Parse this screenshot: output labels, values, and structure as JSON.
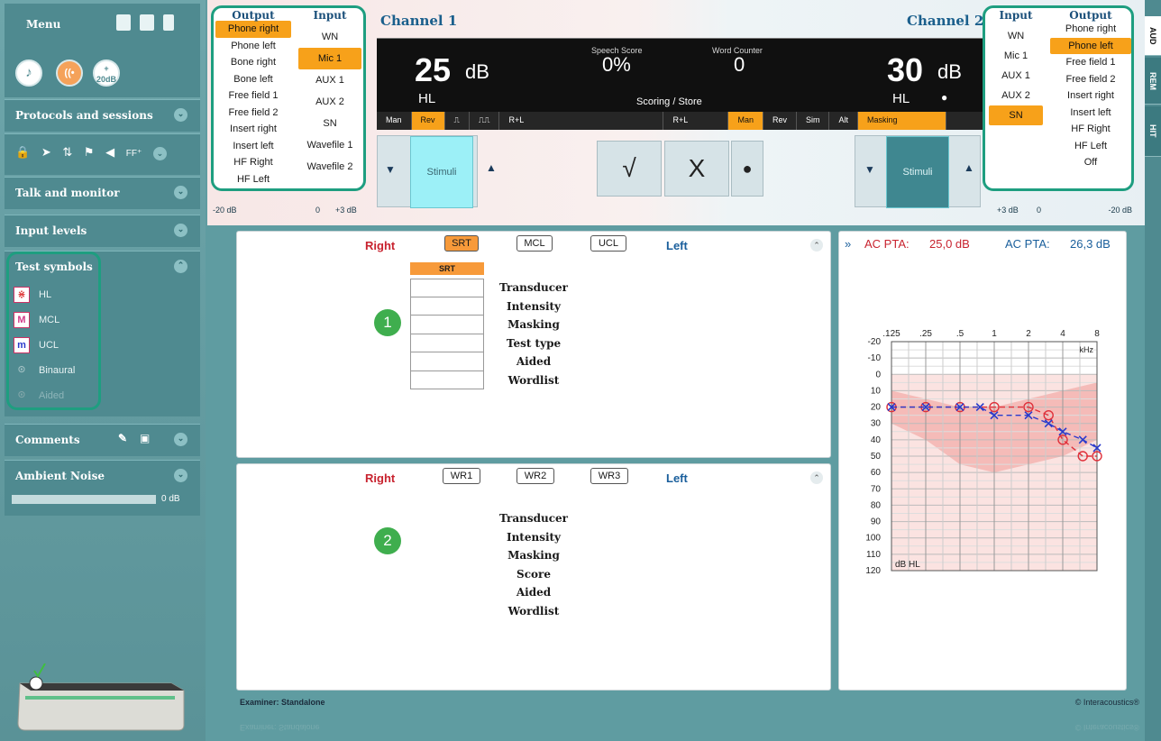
{
  "sidebar": {
    "menu_title": "Menu",
    "mode_icons": [
      "music-note-icon",
      "sound-wave-icon",
      "plus-20db-icon"
    ],
    "plus_20db_label": "+\n20dB",
    "sections": {
      "protocols": "Protocols and sessions",
      "talk": "Talk and monitor",
      "input_levels": "Input levels",
      "test_symbols": "Test symbols",
      "comments": "Comments",
      "ambient": "Ambient Noise"
    },
    "ff_label": "FF⁺",
    "sym_items": [
      {
        "label": "HL",
        "glyph": "⋇"
      },
      {
        "label": "MCL",
        "glyph": "M"
      },
      {
        "label": "UCL",
        "glyph": "m"
      },
      {
        "label": "Binaural",
        "glyph": "⊙"
      },
      {
        "label": "Aided",
        "glyph": "⊙"
      }
    ],
    "ambient_value": "0 dB"
  },
  "channel1": {
    "title": "Channel 1",
    "output_header": "Output",
    "input_header": "Input",
    "outputs": [
      "Phone right",
      "Phone left",
      "Bone right",
      "Bone left",
      "Free field 1",
      "Free field 2",
      "Insert right",
      "Insert left",
      "HF Right",
      "HF Left"
    ],
    "inputs": [
      "WN",
      "Mic 1",
      "AUX 1",
      "AUX 2",
      "SN",
      "Wavefile 1",
      "Wavefile 2"
    ],
    "selected_output": "Phone right",
    "selected_input": "Mic 1",
    "level": "25",
    "unit": "dB",
    "hl": "HL",
    "stim_label": "Stimuli",
    "slider_min": "-20 dB",
    "slider_zero": "0",
    "slider_max": "+3 dB"
  },
  "channel2": {
    "title": "Channel 2",
    "output_header": "Output",
    "input_header": "Input",
    "outputs": [
      "Phone right",
      "Phone left",
      "Free field 1",
      "Free field 2",
      "Insert right",
      "Insert left",
      "HF Right",
      "HF Left",
      "Off"
    ],
    "inputs": [
      "WN",
      "Mic 1",
      "AUX 1",
      "AUX 2",
      "SN"
    ],
    "selected_output": "Phone left",
    "selected_input": "SN",
    "level": "30",
    "unit": "dB",
    "hl": "HL",
    "stim_label": "Stimuli",
    "slider_min": "+3 dB",
    "slider_zero": "0",
    "slider_max": "-20 dB"
  },
  "display": {
    "speech_score_label": "Speech Score",
    "speech_score": "0%",
    "word_counter_label": "Word Counter",
    "word_counter": "0",
    "scoring": "Scoring  /  Store",
    "modes_left": [
      "Man",
      "Rev",
      "⎍",
      "⎍⎍",
      "R+L"
    ],
    "modes_right": [
      "R+L",
      "Man",
      "Rev",
      "Sim",
      "Alt",
      "Masking"
    ]
  },
  "score_buttons": {
    "correct": "√",
    "wrong": "X",
    "record": "●"
  },
  "srt_panel": {
    "right": "Right",
    "left": "Left",
    "tabs": [
      "SRT",
      "MCL",
      "UCL"
    ],
    "active_tab": "SRT",
    "col_header": "SRT",
    "rows": [
      "Transducer",
      "Intensity",
      "Masking",
      "Test type",
      "Aided",
      "Wordlist"
    ],
    "badge": "1"
  },
  "wr_panel": {
    "right": "Right",
    "left": "Left",
    "tabs": [
      "WR1",
      "WR2",
      "WR3"
    ],
    "rows": [
      "Transducer",
      "Intensity",
      "Masking",
      "Score",
      "Aided",
      "Wordlist"
    ],
    "badge": "2"
  },
  "audiogram": {
    "pta_label_right": "AC PTA:",
    "pta_value_right": "25,0 dB",
    "pta_label_left": "AC PTA:",
    "pta_value_left": "26,3 dB",
    "freq_labels": [
      ".125",
      ".25",
      ".5",
      "1",
      "2",
      "4",
      "8"
    ],
    "khz": "kHz",
    "db_labels": [
      "-20",
      "-10",
      "0",
      "10",
      "20",
      "30",
      "40",
      "50",
      "60",
      "70",
      "80",
      "90",
      "100",
      "110",
      "120"
    ],
    "unit_label": "dB HL"
  },
  "chart_data": {
    "type": "line",
    "x_label": "kHz",
    "y_label": "dB HL",
    "ylim": [
      -20,
      120
    ],
    "y_inverted": true,
    "x_ticks": [
      ".125",
      ".25",
      ".5",
      "1",
      "2",
      "4",
      "8"
    ],
    "series": [
      {
        "name": "Right",
        "color": "#e0303a",
        "marker": "circle",
        "x": [
          0.125,
          0.25,
          0.5,
          1,
          2,
          3,
          4,
          6,
          8
        ],
        "y": [
          20,
          20,
          20,
          20,
          20,
          25,
          40,
          50,
          50
        ]
      },
      {
        "name": "Left",
        "color": "#2a3acc",
        "marker": "cross",
        "x": [
          0.125,
          0.25,
          0.5,
          0.75,
          1,
          2,
          3,
          4,
          6,
          8
        ],
        "y": [
          20,
          20,
          20,
          20,
          25,
          25,
          30,
          35,
          40,
          45
        ]
      }
    ],
    "banana_color": "#f3b4b0"
  },
  "right_tabs": [
    "AUD",
    "REM",
    "HIT"
  ],
  "footer": {
    "examiner": "Examiner: Standalone",
    "copyright": "© Interacoustics®"
  },
  "colors": {
    "accent": "#f7a11a",
    "highlight_ring": "#1e9e80",
    "right_ear": "#c8232f",
    "left_ear": "#1a5f9c"
  }
}
